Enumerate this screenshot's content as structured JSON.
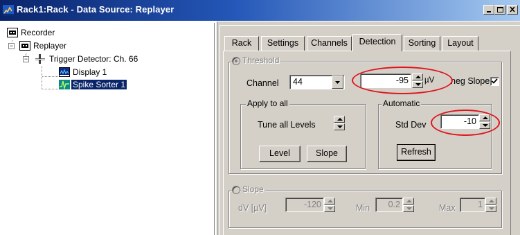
{
  "window": {
    "title": "Rack1:Rack - Data Source: Replayer",
    "icon": "app-icon"
  },
  "tree": {
    "items": [
      {
        "label": "Recorder",
        "icon": "recorder-icon"
      },
      {
        "label": "Replayer",
        "icon": "replayer-icon"
      },
      {
        "label": "Trigger Detector: Ch. 66",
        "icon": "trigger-detector-icon"
      },
      {
        "label": "Display 1",
        "icon": "display-icon"
      },
      {
        "label": "Spike Sorter 1",
        "icon": "spike-sorter-icon",
        "selected": true
      }
    ]
  },
  "tabs": [
    {
      "label": "Rack"
    },
    {
      "label": "Settings"
    },
    {
      "label": "Channels"
    },
    {
      "label": "Detection",
      "active": true
    },
    {
      "label": "Sorting"
    },
    {
      "label": "Layout"
    }
  ],
  "threshold": {
    "title": "Threshold",
    "channel_label": "Channel",
    "channel_value": "44",
    "level_value": "-95",
    "unit": "µV",
    "neg_slope_label": "neg Slope",
    "neg_slope_checked": true
  },
  "apply_all": {
    "title": "Apply to all",
    "tune_label": "Tune all Levels",
    "level_button": "Level",
    "slope_button": "Slope"
  },
  "automatic": {
    "title": "Automatic",
    "std_dev_label": "Std Dev",
    "std_dev_value": "-10",
    "refresh_button": "Refresh"
  },
  "slope": {
    "title": "Slope",
    "dv_label": "dV [µV]",
    "dv_value": "-120",
    "min_label": "Min",
    "min_value": "0.2",
    "max_label": "Max",
    "max_value": "1"
  },
  "colors": {
    "highlight": "#e0141e",
    "titlebar_start": "#0a246a",
    "face": "#d4d0c8"
  }
}
